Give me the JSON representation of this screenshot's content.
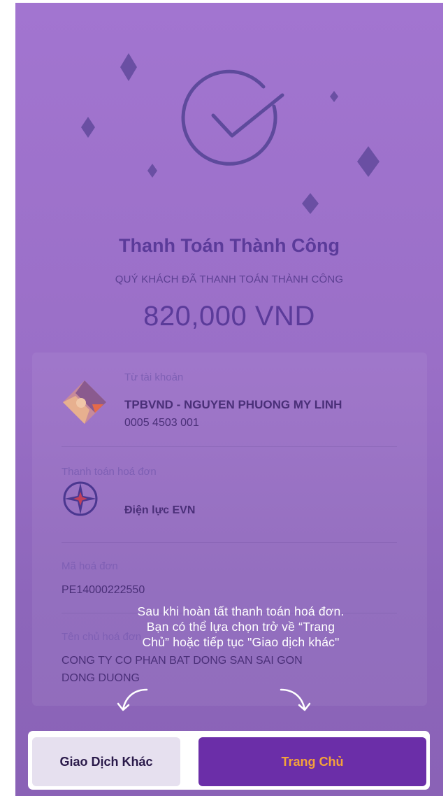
{
  "result": {
    "title": "Thanh Toán Thành Công",
    "subtitle": "QUÝ KHÁCH ĐÃ THANH TOÁN THÀNH CÔNG",
    "amount": "820,000 VND"
  },
  "from_account": {
    "label": "Từ tài khoản",
    "name": "TPBVND - NGUYEN PHUONG MY LINH",
    "number": "0005 4503 001"
  },
  "bill": {
    "label": "Thanh toán hoá đơn",
    "provider": "Điện lực EVN"
  },
  "bill_code": {
    "label": "Mã hoá đơn",
    "value": "PE14000222550"
  },
  "bill_owner": {
    "label": "Tên chủ hoá đơn",
    "value_line1": "CONG TY CO PHAN BAT DONG SAN SAI GON",
    "value_line2": "DONG DUONG"
  },
  "tutorial": {
    "line1": "Sau khi hoàn tất thanh toán hoá đơn.",
    "line2": "Bạn có thể lựa chọn trở về “Trang",
    "line3": "Chủ” hoặc tiếp tục \"Giao dịch khác\""
  },
  "actions": {
    "other_transaction": "Giao Dịch Khác",
    "home": "Trang Chủ"
  },
  "colors": {
    "background": "#9a6fc7",
    "accent_purple": "#6b2ea8",
    "home_label": "#f4a23a"
  },
  "icons": [
    "sparkle-icon",
    "check-circle-icon",
    "avatar-icon",
    "evn-logo-icon",
    "curved-arrow-left-icon",
    "curved-arrow-right-icon"
  ]
}
